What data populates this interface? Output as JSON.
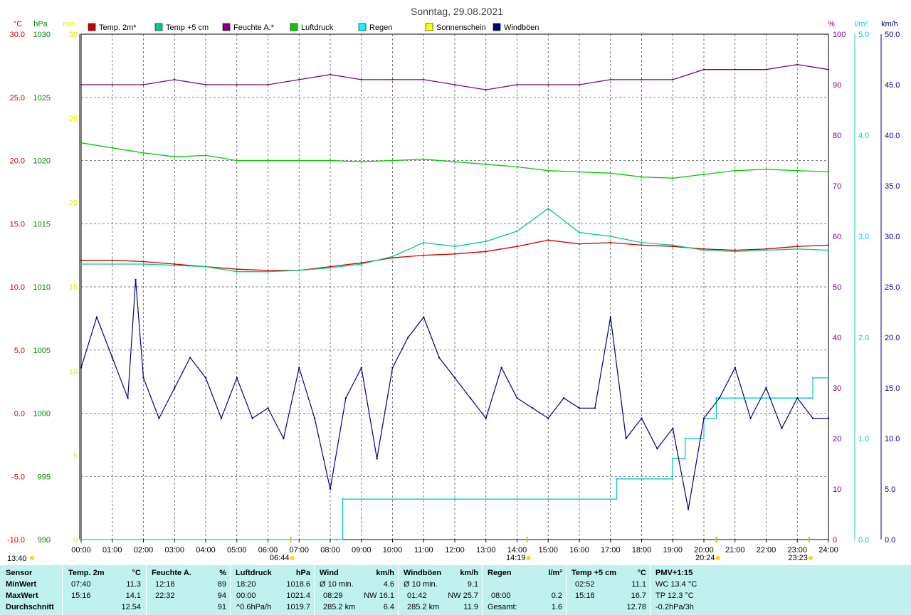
{
  "chart_data": {
    "type": "line",
    "title": "Sonntag, 29.08.2021",
    "x_ticks": [
      "00:00",
      "01:00",
      "02:00",
      "03:00",
      "04:00",
      "05:00",
      "06:00",
      "07:00",
      "08:00",
      "09:00",
      "10:00",
      "11:00",
      "12:00",
      "13:00",
      "14:00",
      "15:00",
      "16:00",
      "17:00",
      "18:00",
      "19:00",
      "20:00",
      "21:00",
      "22:00",
      "23:00",
      "24:00"
    ],
    "sun_events": [
      {
        "label": "06:44",
        "hour": 6.73
      },
      {
        "label": "14:19",
        "hour": 14.32
      },
      {
        "label": "20:24",
        "hour": 20.4
      },
      {
        "label": "23:23",
        "hour": 23.38
      }
    ],
    "moon_label": "13:40",
    "axes": {
      "temp_c": {
        "unit": "°C",
        "range": [
          -10,
          30
        ],
        "ticks": [
          "30.0",
          "25.0",
          "20.0",
          "15.0",
          "10.0",
          "5.0",
          "0.0",
          "-5.0",
          "-10.0"
        ],
        "color": "#cc0000"
      },
      "pressure_hpa": {
        "unit": "hPa",
        "range": [
          990,
          1030
        ],
        "ticks": [
          "1030",
          "1025",
          "1020",
          "1015",
          "1010",
          "1005",
          "1000",
          "995",
          "990"
        ],
        "color": "#008800"
      },
      "sun_min": {
        "unit": "min",
        "range": [
          0,
          30
        ],
        "ticks": [
          "30",
          "25",
          "20",
          "15",
          "10",
          "5",
          "0"
        ],
        "color": "#e6e600"
      },
      "humidity_pct": {
        "unit": "%",
        "range": [
          0,
          100
        ],
        "ticks": [
          "100",
          "90",
          "80",
          "70",
          "60",
          "50",
          "40",
          "30",
          "20",
          "10",
          "0"
        ],
        "color": "#800080"
      },
      "rain_lm2": {
        "unit": "l/m²",
        "range": [
          0,
          5
        ],
        "ticks": [
          "5.0",
          "4.0",
          "3.0",
          "2.0",
          "1.0",
          "0.0"
        ],
        "color": "#00cccc"
      },
      "wind_kmh": {
        "unit": "km/h",
        "range": [
          0,
          50
        ],
        "ticks": [
          "50.0",
          "45.0",
          "40.0",
          "35.0",
          "30.0",
          "25.0",
          "20.0",
          "15.0",
          "10.0",
          "5.0",
          "0.0"
        ],
        "color": "#000080"
      }
    },
    "legend": [
      {
        "name": "Temp. 2m*",
        "color": "#cc0000"
      },
      {
        "name": "Temp +5 cm",
        "color": "#00cc88"
      },
      {
        "name": "Feuchte A.*",
        "color": "#800080"
      },
      {
        "name": "Luftdruck",
        "color": "#00cc00"
      },
      {
        "name": "Regen",
        "color": "#00ffff"
      },
      {
        "name": "Sonnenschein",
        "color": "#ffff00"
      },
      {
        "name": "Windböen",
        "color": "#000080"
      }
    ],
    "series": [
      {
        "name": "Temp. 2m*",
        "axis": "temp_c",
        "color": "#cc0000",
        "x": [
          0,
          1,
          2,
          3,
          4,
          5,
          6,
          7,
          8,
          9,
          10,
          11,
          12,
          13,
          14,
          15,
          16,
          17,
          18,
          19,
          20,
          21,
          22,
          23,
          24
        ],
        "values": [
          12.1,
          12.1,
          12.0,
          11.8,
          11.6,
          11.4,
          11.3,
          11.3,
          11.6,
          11.9,
          12.3,
          12.5,
          12.6,
          12.8,
          13.2,
          13.7,
          13.4,
          13.5,
          13.3,
          13.2,
          13.0,
          12.9,
          13.0,
          13.2,
          13.3
        ]
      },
      {
        "name": "Temp +5 cm",
        "axis": "temp_c",
        "color": "#00cc88",
        "x": [
          0,
          1,
          2,
          3,
          4,
          5,
          6,
          7,
          8,
          9,
          10,
          11,
          12,
          13,
          14,
          15,
          16,
          17,
          18,
          19,
          20,
          21,
          22,
          23,
          24
        ],
        "values": [
          11.8,
          11.8,
          11.8,
          11.7,
          11.6,
          11.2,
          11.2,
          11.3,
          11.5,
          11.8,
          12.4,
          13.5,
          13.2,
          13.6,
          14.4,
          16.2,
          14.3,
          14.0,
          13.5,
          13.3,
          12.9,
          12.8,
          12.9,
          13.0,
          12.9
        ]
      },
      {
        "name": "Feuchte A.*",
        "axis": "humidity_pct",
        "color": "#800080",
        "x": [
          0,
          1,
          2,
          3,
          4,
          5,
          6,
          7,
          8,
          9,
          10,
          11,
          12,
          13,
          14,
          15,
          16,
          17,
          18,
          19,
          20,
          21,
          22,
          23,
          24
        ],
        "values": [
          90,
          90,
          90,
          91,
          90,
          90,
          90,
          91,
          92,
          91,
          91,
          91,
          90,
          89,
          90,
          90,
          90,
          91,
          91,
          91,
          93,
          93,
          93,
          94,
          93
        ]
      },
      {
        "name": "Luftdruck",
        "axis": "pressure_hpa",
        "color": "#00cc00",
        "x": [
          0,
          1,
          2,
          3,
          4,
          5,
          6,
          7,
          8,
          9,
          10,
          11,
          12,
          13,
          14,
          15,
          16,
          17,
          18,
          19,
          20,
          21,
          22,
          23,
          24
        ],
        "values": [
          1021.4,
          1021.0,
          1020.6,
          1020.3,
          1020.4,
          1020.0,
          1020.0,
          1020.0,
          1020.0,
          1019.9,
          1020.0,
          1020.1,
          1019.9,
          1019.7,
          1019.5,
          1019.2,
          1019.1,
          1019.0,
          1018.7,
          1018.6,
          1018.9,
          1019.2,
          1019.3,
          1019.2,
          1019.1
        ]
      },
      {
        "name": "Regen",
        "axis": "rain_lm2",
        "color": "#00cccc",
        "x": [
          0,
          8.2,
          8.4,
          12.0,
          17.2,
          19.0,
          19.4,
          20.0,
          20.4,
          23.4,
          23.5,
          24
        ],
        "values": [
          0,
          0,
          0.4,
          0.4,
          0.6,
          0.8,
          1.0,
          1.2,
          1.4,
          1.4,
          1.6,
          1.6
        ]
      },
      {
        "name": "Windböen",
        "axis": "wind_kmh",
        "color": "#000080",
        "x": [
          0,
          0.5,
          1,
          1.5,
          1.75,
          2,
          2.5,
          3,
          3.5,
          4,
          4.5,
          5,
          5.5,
          6,
          6.5,
          7,
          7.5,
          8,
          8.5,
          9,
          9.5,
          10,
          10.5,
          11,
          11.5,
          12,
          12.5,
          13,
          13.5,
          14,
          14.5,
          15,
          15.5,
          16,
          16.5,
          17,
          17.5,
          18,
          18.5,
          19,
          19.5,
          20,
          20.5,
          21,
          21.5,
          22,
          22.5,
          23,
          23.5,
          24
        ],
        "values": [
          17,
          22,
          18,
          14,
          25.7,
          16,
          12,
          15,
          18,
          16,
          12,
          16,
          12,
          13,
          10,
          17,
          12,
          5,
          14,
          17,
          8,
          17,
          20,
          22,
          18,
          16,
          14,
          12,
          17,
          14,
          13,
          12,
          14,
          13,
          13,
          22,
          10,
          12,
          9,
          11,
          3,
          12,
          14,
          17,
          12,
          15,
          11,
          14,
          12,
          12
        ]
      }
    ]
  },
  "stats": {
    "headers": [
      "Sensor",
      "Temp. 2m",
      "°C",
      "Feuchte A.",
      "%",
      "Luftdruck",
      "hPa",
      "Wind",
      "km/h",
      "Windböen",
      "km/h",
      "Regen",
      "l/m²",
      "Temp +5 cm",
      "°C",
      "PMV+1:15"
    ],
    "row_labels": [
      "MinWert",
      "MaxWert",
      "Durchschnitt"
    ],
    "temp2m": {
      "min_time": "07:40",
      "min": "11.3",
      "max_time": "15:16",
      "max": "14.1",
      "avg": "12.54"
    },
    "humidity": {
      "min_time": "12:18",
      "min": "89",
      "max_time": "22:32",
      "max": "94",
      "avg": "91"
    },
    "pressure": {
      "min_time": "18:20",
      "min": "1018.6",
      "max_time": "00:00",
      "max": "1021.4",
      "trend": "^0.6hPa/h",
      "avg": "1019.7"
    },
    "wind": {
      "min_label": "Ø 10 min.",
      "min": "4.6",
      "max_time": "08:29",
      "max_dir": "NW 16.1",
      "dist": "285.2 km",
      "avg": "6.4"
    },
    "gusts": {
      "min_label": "Ø 10 min.",
      "min": "9.1",
      "max_time": "01:42",
      "max_dir": "NW 25.7",
      "dist": "285.2 km",
      "avg": "11.9"
    },
    "rain": {
      "max_time": "08:00",
      "max": "0.2",
      "total_label": "Gesamt:",
      "total": "1.6"
    },
    "temp5": {
      "min_time": "02:52",
      "min": "11.1",
      "max_time": "15:18",
      "max": "16.7",
      "avg": "12.78"
    },
    "pmv": {
      "wc": "WC 13.4 °C",
      "tp": "TP 12.3 °C",
      "trend": "-0.2hPa/3h"
    }
  }
}
